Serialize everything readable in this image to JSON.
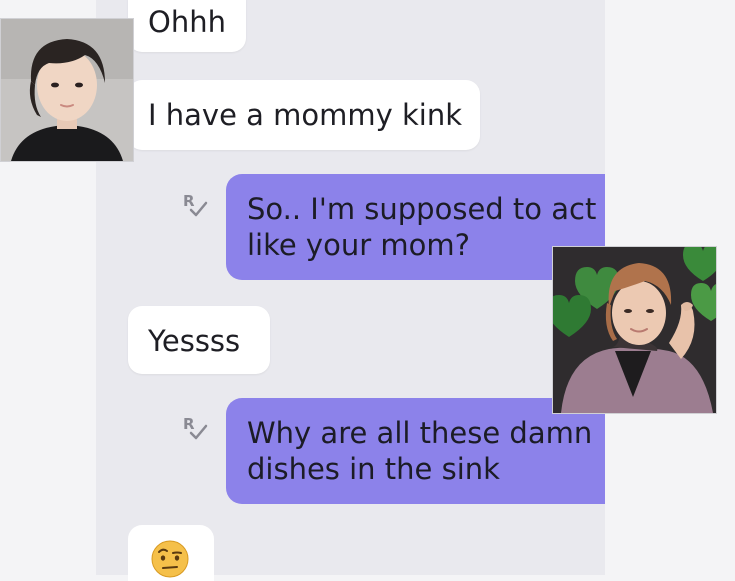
{
  "messages": [
    {
      "id": "m1",
      "direction": "incoming",
      "lines": [
        "Ohhh"
      ]
    },
    {
      "id": "m2",
      "direction": "incoming",
      "lines": [
        "I have a mommy kink"
      ]
    },
    {
      "id": "m3",
      "direction": "outgoing",
      "lines": [
        "So.. I'm supposed to act",
        "like your mom?"
      ],
      "receipt": "R"
    },
    {
      "id": "m4",
      "direction": "incoming",
      "lines": [
        "Yessss"
      ]
    },
    {
      "id": "m5",
      "direction": "outgoing",
      "lines": [
        "Why are all these damn",
        "dishes in the sink"
      ],
      "receipt": "R"
    },
    {
      "id": "m6",
      "direction": "incoming",
      "emoji": "🤨"
    }
  ],
  "colors": {
    "outgoing_bubble": "#8c82ea",
    "incoming_bubble": "#ffffff",
    "chat_background": "#e9e9ee",
    "receipt_icon": "#8a8a93"
  },
  "overlays": [
    {
      "id": "photo-left",
      "subject": "portrait photo, dark-haired person in black top"
    },
    {
      "id": "photo-right",
      "subject": "portrait photo, person in pink jacket with green heart balloons"
    }
  ]
}
